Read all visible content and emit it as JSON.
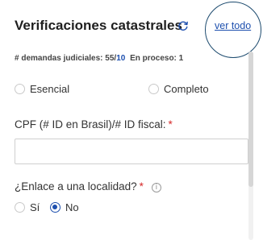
{
  "header": {
    "title": "Verificaciones catastrales",
    "refresh_icon": "refresh-icon",
    "view_all_label": "ver todo"
  },
  "stats": {
    "label": "# demandas judiciales:",
    "count": "55/",
    "limit": "10",
    "in_progress": "En proceso: 1"
  },
  "plan_options": [
    {
      "label": "Esencial",
      "selected": false
    },
    {
      "label": "Completo",
      "selected": false
    }
  ],
  "tax_id": {
    "label": "CPF (# ID en Brasil)/# ID fiscal:",
    "required_mark": "*",
    "value": ""
  },
  "locality": {
    "label": "¿Enlace a una localidad?",
    "required_mark": "*",
    "info_icon": "info-icon",
    "options": [
      {
        "label": "Sí",
        "selected": false
      },
      {
        "label": "No",
        "selected": true
      }
    ]
  },
  "colors": {
    "accent": "#1d4fae",
    "required": "#d62828",
    "highlight_ring": "#1c4a6e"
  }
}
